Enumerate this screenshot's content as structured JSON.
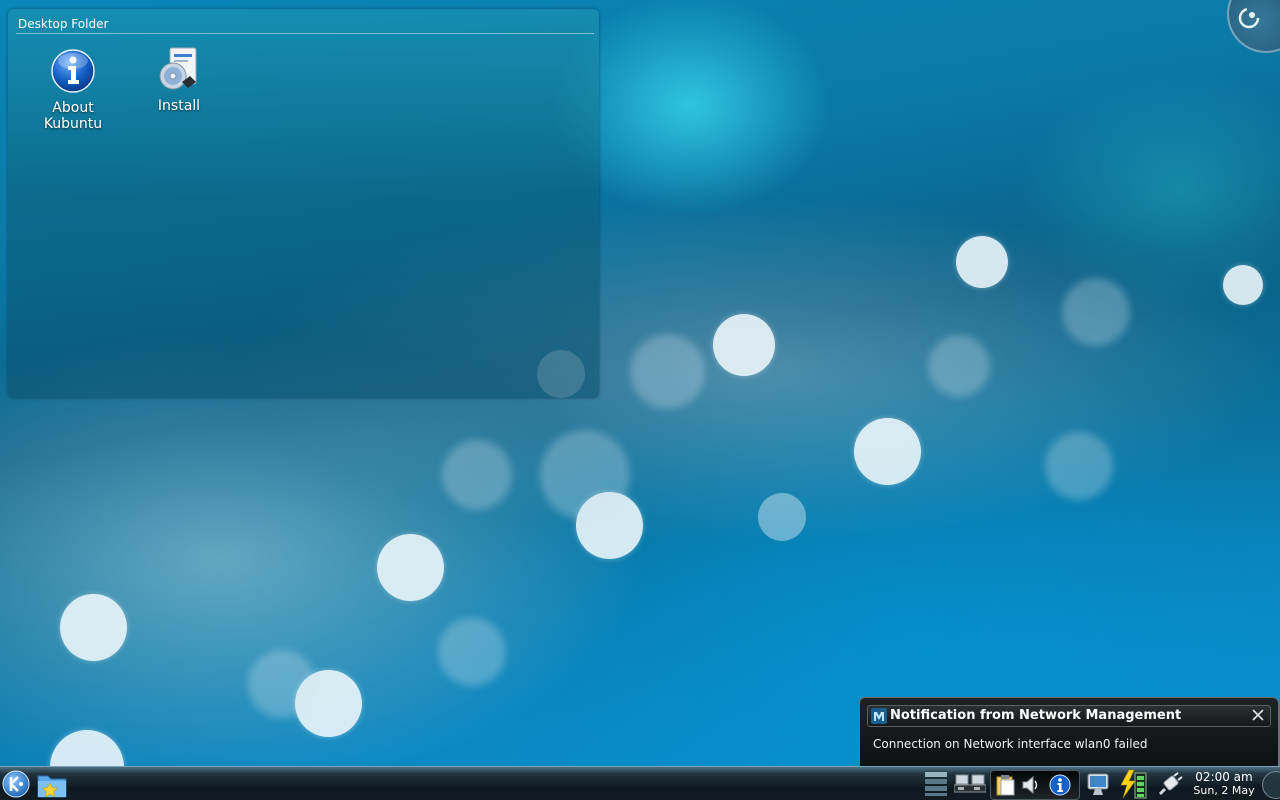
{
  "desktop": {
    "folder_view": {
      "title": "Desktop Folder",
      "icons": [
        {
          "label_line1": "About",
          "label_line2": "Kubuntu",
          "icon": "info-icon"
        },
        {
          "label_line1": "Install",
          "label_line2": "",
          "icon": "install-cd-icon"
        }
      ]
    }
  },
  "notification": {
    "app_icon": "network-management-icon",
    "title": "Notification from Network Management",
    "body": "Connection on Network interface wlan0 failed",
    "close_icon": "close-icon"
  },
  "panel": {
    "launcher_icon": "kde-kickoff-icon",
    "folder_icon": "folder-favorites-icon",
    "tray_icons": [
      "pager-icon",
      "network-icon",
      "clipboard-icon",
      "volume-icon",
      "info-icon",
      "display-icon",
      "battery-icon",
      "plug-icon"
    ],
    "clock": {
      "time": "02:00 am",
      "date": "Sun, 2 May"
    }
  },
  "colors": {
    "desktop_base": "#0a7aa8",
    "panel_dark": "#0e1a21",
    "notification_bg": "#0d0f10",
    "info_blue": "#1560c8"
  }
}
